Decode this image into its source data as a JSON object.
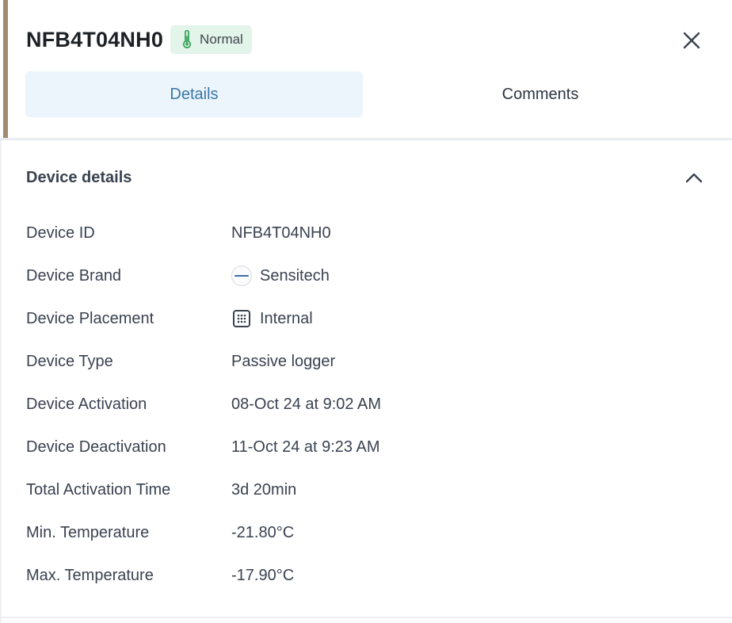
{
  "header": {
    "device_title": "NFB4T04NH0",
    "status": {
      "label": "Normal",
      "icon": "thermometer-icon",
      "color": "#3aa55c"
    },
    "close_icon": "close-icon"
  },
  "tabs": [
    {
      "label": "Details",
      "active": true
    },
    {
      "label": "Comments",
      "active": false
    }
  ],
  "device_details": {
    "title": "Device details",
    "collapse_icon": "chevron-up-icon",
    "rows": [
      {
        "label": "Device ID",
        "value": "NFB4T04NH0"
      },
      {
        "label": "Device Brand",
        "value": "Sensitech",
        "icon": "brand-logo"
      },
      {
        "label": "Device Placement",
        "value": "Internal",
        "icon": "grid-icon"
      },
      {
        "label": "Device Type",
        "value": "Passive logger"
      },
      {
        "label": "Device Activation",
        "value": "08-Oct 24 at 9:02 AM"
      },
      {
        "label": "Device Deactivation",
        "value": "11-Oct 24 at 9:23 AM"
      },
      {
        "label": "Total Activation Time",
        "value": "3d 20min"
      },
      {
        "label": "Min. Temperature",
        "value": "-21.80°C"
      },
      {
        "label": "Max. Temperature",
        "value": "-17.90°C"
      }
    ]
  },
  "colors": {
    "accent_bar": "#a08b6f",
    "active_tab_bg": "#ecf4fc",
    "active_tab_text": "#3877a4",
    "status_badge_bg": "#e3f4ea"
  }
}
